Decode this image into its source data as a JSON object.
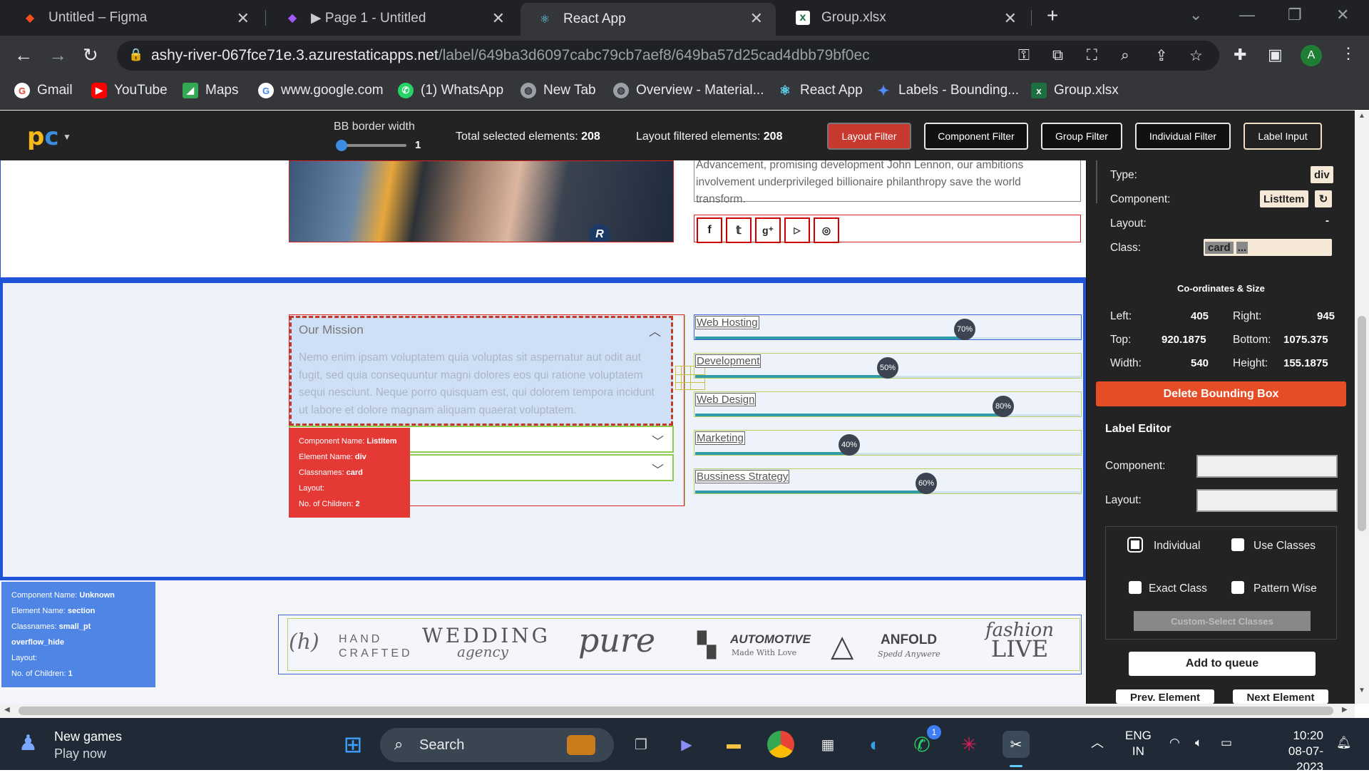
{
  "browser": {
    "tabs": [
      {
        "title": "Untitled – Figma",
        "icon": "figma-icon",
        "active": false
      },
      {
        "title": "▶ Page 1 - Untitled",
        "icon": "figma-icon",
        "active": false
      },
      {
        "title": "React App",
        "icon": "react-icon",
        "active": true
      },
      {
        "title": "Group.xlsx",
        "icon": "excel-icon",
        "active": false
      }
    ],
    "url_host": "ashy-river-067fce71e.3.azurestaticapps.net",
    "url_path": "/label/649ba3d6097cabc79cb7aef8/649ba57d25cad4dbb79bf0ec",
    "profile_initial": "A",
    "bookmarks": [
      "Gmail",
      "YouTube",
      "Maps",
      "www.google.com",
      "(1) WhatsApp",
      "New Tab",
      "Overview - Material...",
      "React App",
      "Labels - Bounding...",
      "Group.xlsx"
    ]
  },
  "header": {
    "bb_label": "BB border width",
    "bb_value": "1",
    "bb_slider_fraction": 0.05,
    "total_label": "Total selected elements:",
    "total_value": "208",
    "layout_label": "Layout filtered elements:",
    "layout_value": "208",
    "buttons": {
      "layout": "Layout Filter",
      "component": "Component Filter",
      "group": "Group Filter",
      "individual": "Individual Filter",
      "label": "Label Input"
    }
  },
  "page": {
    "top_text": "Advancement, promising development John Lennon, our ambitions involvement underprivileged billionaire philanthropy save the world transform.",
    "social": [
      "f",
      "t",
      "g+",
      "yt",
      "ig"
    ],
    "accordion_title": "Our Mission",
    "accordion_body": "Nemo enim ipsam voluptatem quia voluptas sit aspernatur aut odit aut fugit, sed quia consequuntur magni dolores eos qui ratione voluptatem sequi nesciunt. Neque porro quisquam est, qui dolorem tempora incidunt ut labore et dolore magnam aliquam quaerat voluptatem.",
    "skills": [
      {
        "name": "Web Hosting",
        "percent": 70,
        "label": "70%"
      },
      {
        "name": "Development",
        "percent": 50,
        "label": "50%"
      },
      {
        "name": "Web Design",
        "percent": 80,
        "label": "80%"
      },
      {
        "name": "Marketing",
        "percent": 40,
        "label": "40%"
      },
      {
        "name": "Bussiness Strategy",
        "percent": 60,
        "label": "60%"
      }
    ],
    "tooltip_red": {
      "l1": "Component Name:",
      "v1": "ListItem",
      "l2": "Element Name:",
      "v2": "div",
      "l3": "Classnames:",
      "v3": "card",
      "l4": "Layout:",
      "l5": "No. of Children:",
      "v5": "2"
    },
    "tooltip_blue": {
      "l1": "Component Name:",
      "v1": "Unknown",
      "l2": "Element Name:",
      "v2": "section",
      "l3": "Classnames:",
      "v3": "small_pt overflow_hide",
      "l4": "Layout:",
      "l5": "No. of Children:",
      "v5": "1"
    },
    "brands": {
      "b1a": "HAND",
      "b1b": "CRAFTED",
      "b2a": "WEDDING",
      "b2b": "agency",
      "b3": "pure",
      "b4a": "AUTOMOTIVE",
      "b4b": "Made With Love",
      "b5a": "ANFOLD",
      "b5b": "Spedd Anywere",
      "b6a": "fashion",
      "b6b": "LIVE"
    }
  },
  "panel": {
    "type_label": "Type:",
    "type_value": "div",
    "component_label": "Component:",
    "component_value": "ListItem",
    "layout_label": "Layout:",
    "layout_value": "-",
    "class_label": "Class:",
    "class_value": "card",
    "class_more": "...",
    "coords_title": "Co-ordinates & Size",
    "left_label": "Left:",
    "left_value": "405",
    "right_label": "Right:",
    "right_value": "945",
    "top_label": "Top:",
    "top_value": "920.1875",
    "bottom_label": "Bottom:",
    "bottom_value": "1075.375",
    "width_label": "Width:",
    "width_value": "540",
    "height_label": "Height:",
    "height_value": "155.1875",
    "delete_label": "Delete Bounding Box",
    "editor_title": "Label Editor",
    "ed_component_label": "Component:",
    "ed_layout_label": "Layout:",
    "opt_individual": "Individual",
    "opt_use_classes": "Use Classes",
    "opt_exact_class": "Exact Class",
    "opt_pattern_wise": "Pattern Wise",
    "custom_select": "Custom-Select Classes",
    "add_queue": "Add to queue",
    "prev": "Prev. Element",
    "next": "Next Element"
  },
  "taskbar": {
    "news_title": "New games",
    "news_sub": "Play now",
    "search": "Search",
    "lang1": "ENG",
    "lang2": "IN",
    "time": "10:20",
    "date": "08-07-2023",
    "whatsapp_badge": "1"
  }
}
